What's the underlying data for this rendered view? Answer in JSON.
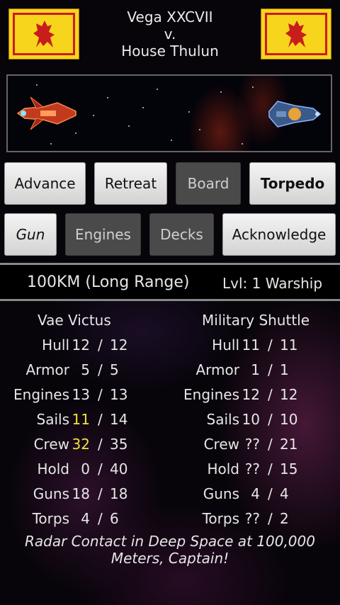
{
  "header": {
    "player": "Vega XXCVII",
    "versus": "v.",
    "opponent": "House Thulun"
  },
  "buttons": {
    "advance": "Advance",
    "retreat": "Retreat",
    "board": "Board",
    "torpedo": "Torpedo",
    "gun": "Gun",
    "engines": "Engines",
    "decks": "Decks",
    "acknowledge": "Acknowledge"
  },
  "range": {
    "distance": "100KM (Long Range)",
    "level": "Lvl: 1 Warship"
  },
  "player_ship": {
    "name": "Vae Victus",
    "stats": [
      {
        "label": "Hull",
        "cur": "12",
        "max": "12"
      },
      {
        "label": "Armor",
        "cur": "5",
        "max": "5"
      },
      {
        "label": "Engines",
        "cur": "13",
        "max": "13"
      },
      {
        "label": "Sails",
        "cur": "11",
        "max": "14"
      },
      {
        "label": "Crew",
        "cur": "32",
        "max": "35"
      },
      {
        "label": "Hold",
        "cur": "0",
        "max": "40"
      },
      {
        "label": "Guns",
        "cur": "18",
        "max": "18"
      },
      {
        "label": "Torps",
        "cur": "4",
        "max": "6"
      }
    ]
  },
  "enemy_ship": {
    "name": "Military Shuttle",
    "stats": [
      {
        "label": "Hull",
        "cur": "11",
        "max": "11"
      },
      {
        "label": "Armor",
        "cur": "1",
        "max": "1"
      },
      {
        "label": "Engines",
        "cur": "12",
        "max": "12"
      },
      {
        "label": "Sails",
        "cur": "10",
        "max": "10"
      },
      {
        "label": "Crew",
        "cur": "??",
        "max": "21"
      },
      {
        "label": "Hold",
        "cur": "??",
        "max": "15"
      },
      {
        "label": "Guns",
        "cur": "4",
        "max": "4"
      },
      {
        "label": "Torps",
        "cur": "??",
        "max": "2"
      }
    ]
  },
  "separator": "/",
  "message": "Radar Contact in Deep Space at 100,000 Meters, Captain!",
  "colors": {
    "highlight": "#f6e03a",
    "flag_field": "#f7d51c",
    "flag_lion": "#c81d1d"
  }
}
